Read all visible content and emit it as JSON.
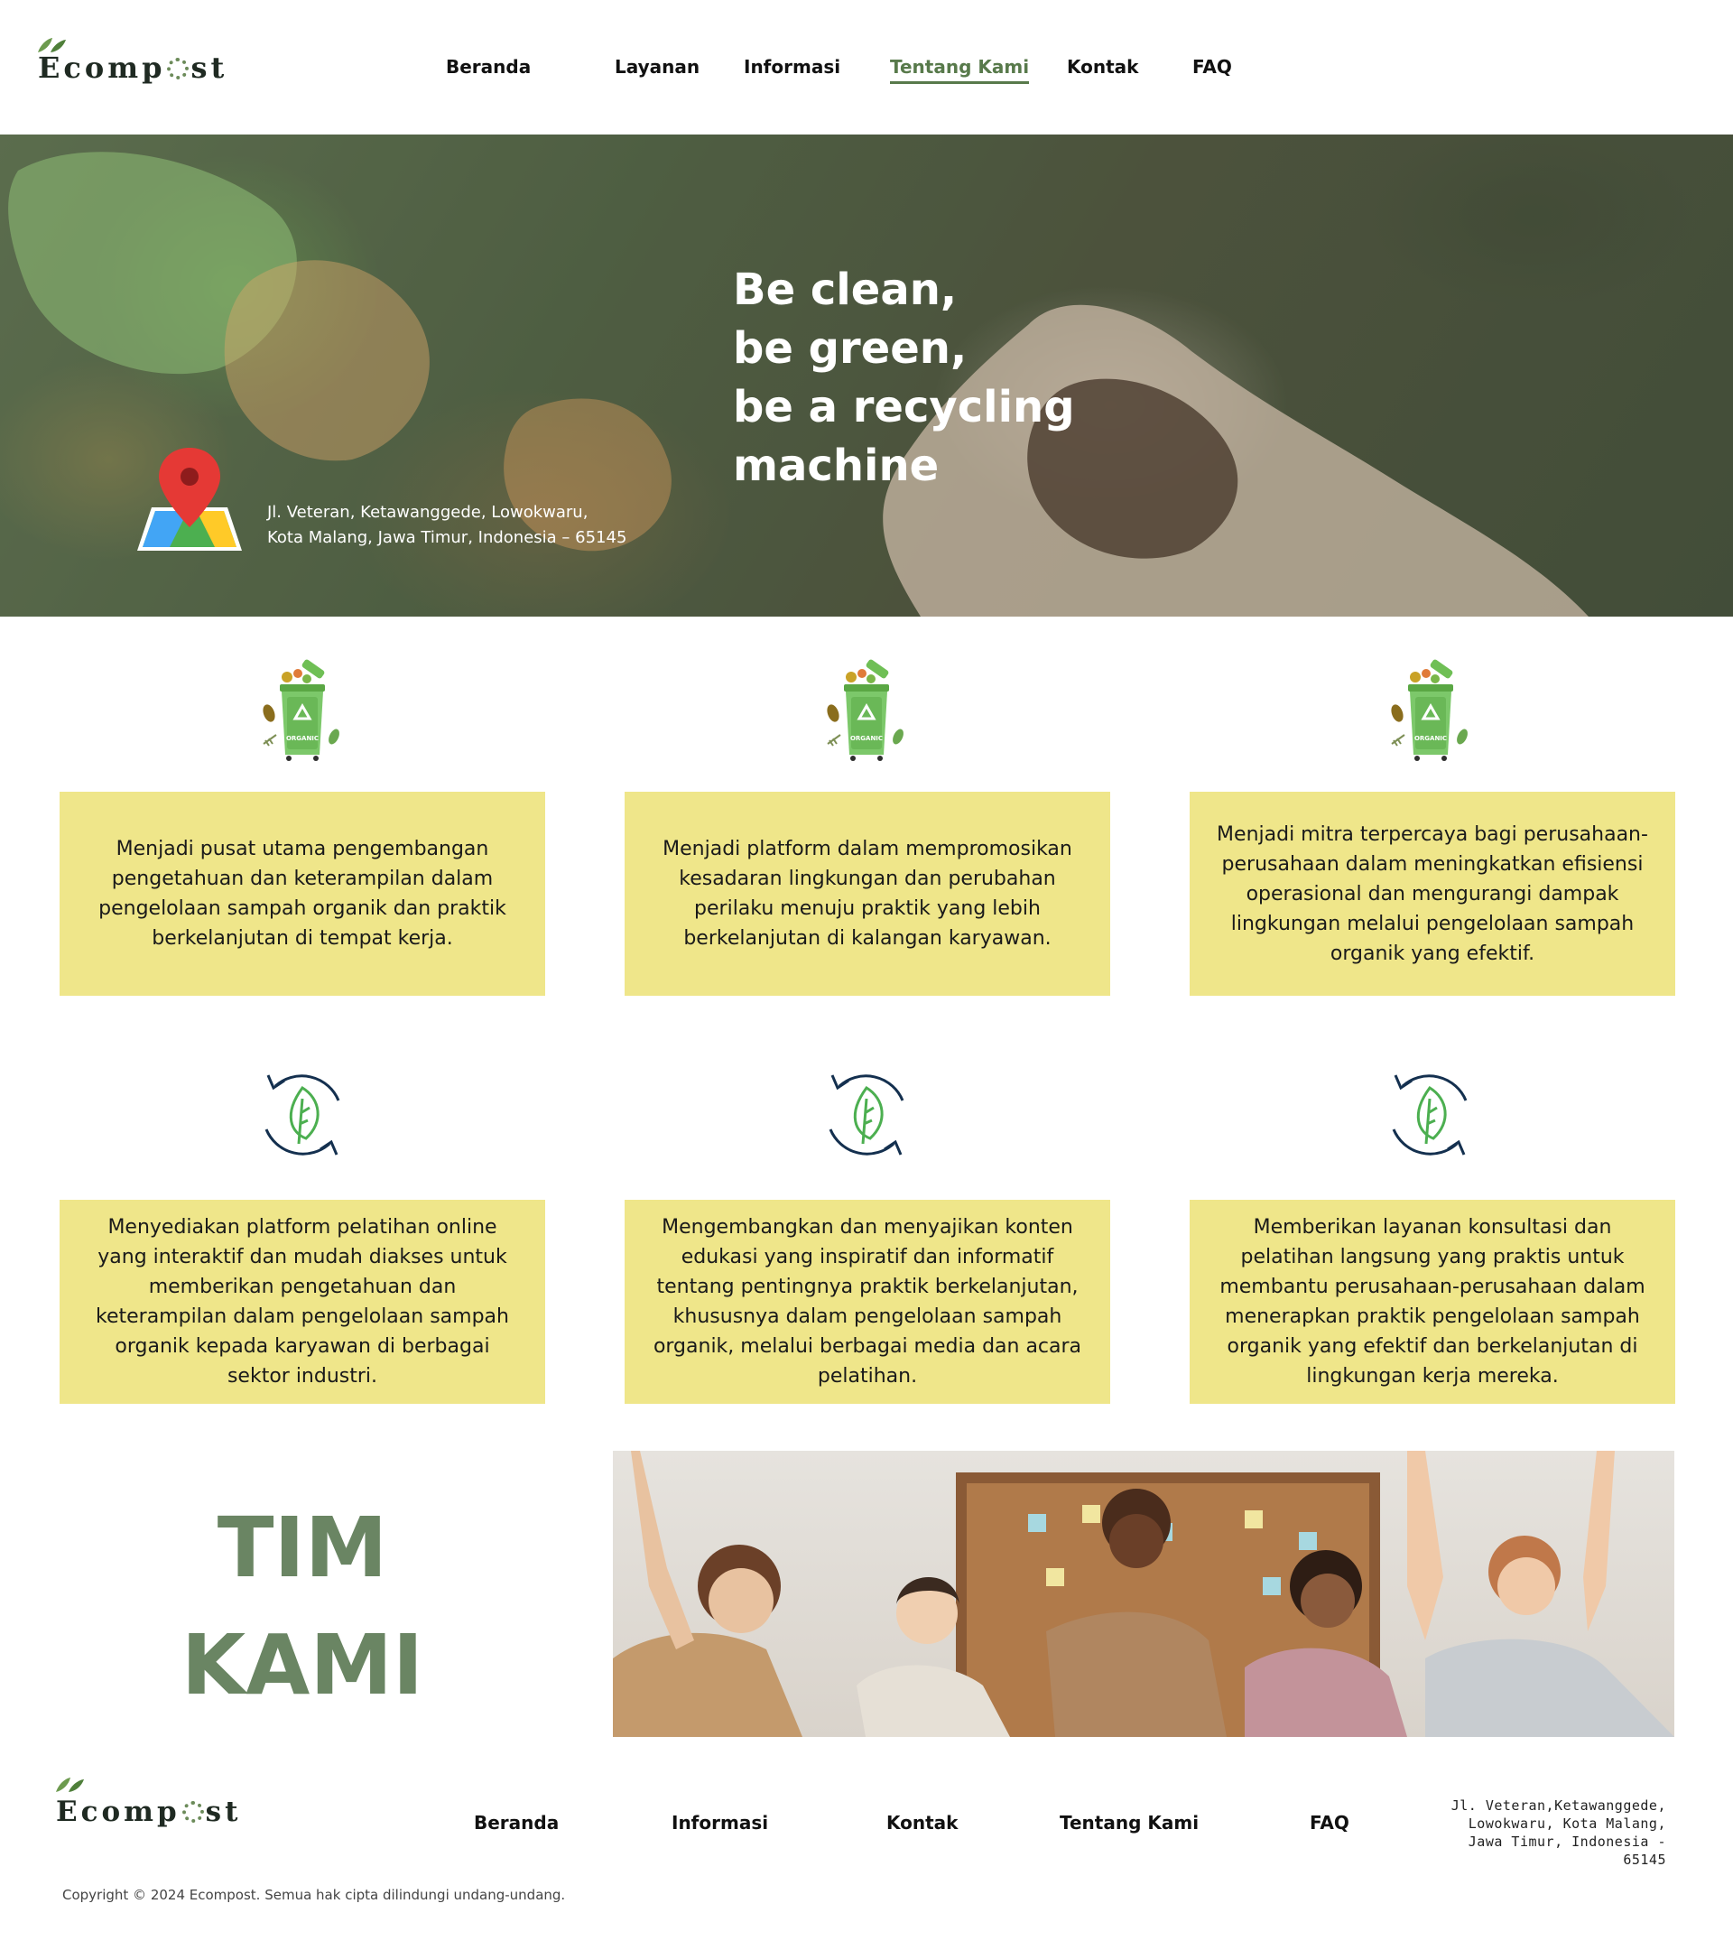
{
  "brand": {
    "name_part1": "Ecomp",
    "name_part2": "st"
  },
  "nav": {
    "items": [
      {
        "label": "Beranda"
      },
      {
        "label": "Layanan"
      },
      {
        "label": "Informasi"
      },
      {
        "label": "Tentang Kami",
        "active": true
      },
      {
        "label": "Kontak"
      },
      {
        "label": "FAQ"
      }
    ]
  },
  "hero": {
    "title_lines": [
      "Be clean,",
      "be green,",
      "be a recycling",
      "machine"
    ],
    "address_lines": [
      "Jl. Veteran, Ketawanggede, Lowokwaru,",
      "Kota Malang, Jawa Timur, Indonesia – 65145"
    ]
  },
  "cards": {
    "row1_icon": "organic-bin-icon",
    "row1_icon_label": "ORGANIC",
    "row2_icon": "recycle-leaf-icon",
    "row1": [
      "Menjadi pusat utama pengembangan pengetahuan dan keterampilan dalam pengelolaan sampah organik dan praktik berkelanjutan di tempat kerja.",
      "Menjadi platform dalam mempromosikan kesadaran lingkungan dan perubahan perilaku menuju praktik yang lebih berkelanjutan di kalangan karyawan.",
      "Menjadi mitra terpercaya bagi perusahaan-perusahaan dalam meningkatkan efisiensi operasional dan mengurangi dampak lingkungan melalui pengelolaan sampah organik yang efektif."
    ],
    "row2": [
      "Menyediakan platform pelatihan online yang interaktif dan mudah diakses untuk memberikan pengetahuan dan keterampilan dalam pengelolaan sampah organik kepada karyawan di berbagai sektor industri.",
      "Mengembangkan dan menyajikan konten edukasi yang inspiratif dan informatif tentang pentingnya praktik berkelanjutan, khususnya dalam pengelolaan sampah organik, melalui berbagai media dan acara pelatihan.",
      "Memberikan layanan konsultasi dan pelatihan langsung yang praktis untuk membantu perusahaan-perusahaan dalam menerapkan praktik pengelolaan sampah organik yang efektif dan berkelanjutan di lingkungan kerja mereka."
    ]
  },
  "team": {
    "title_line1": "TIM",
    "title_line2": "KAMI"
  },
  "footer": {
    "nav": [
      {
        "label": "Beranda"
      },
      {
        "label": "Informasi"
      },
      {
        "label": "Kontak"
      },
      {
        "label": "Tentang Kami"
      },
      {
        "label": "FAQ"
      }
    ],
    "address": "Jl. Veteran,Ketawanggede, Lowokwaru, Kota Malang, Jawa Timur, Indonesia - 65145",
    "copyright": "Copyright © 2024 Ecompost. Semua hak cipta dilindungi undang-undang."
  },
  "colors": {
    "accent_green": "#587a4b",
    "card_yellow": "#efe68a",
    "team_title": "#6a8563",
    "icon_navy": "#14304f",
    "icon_leaf": "#4caf50"
  }
}
